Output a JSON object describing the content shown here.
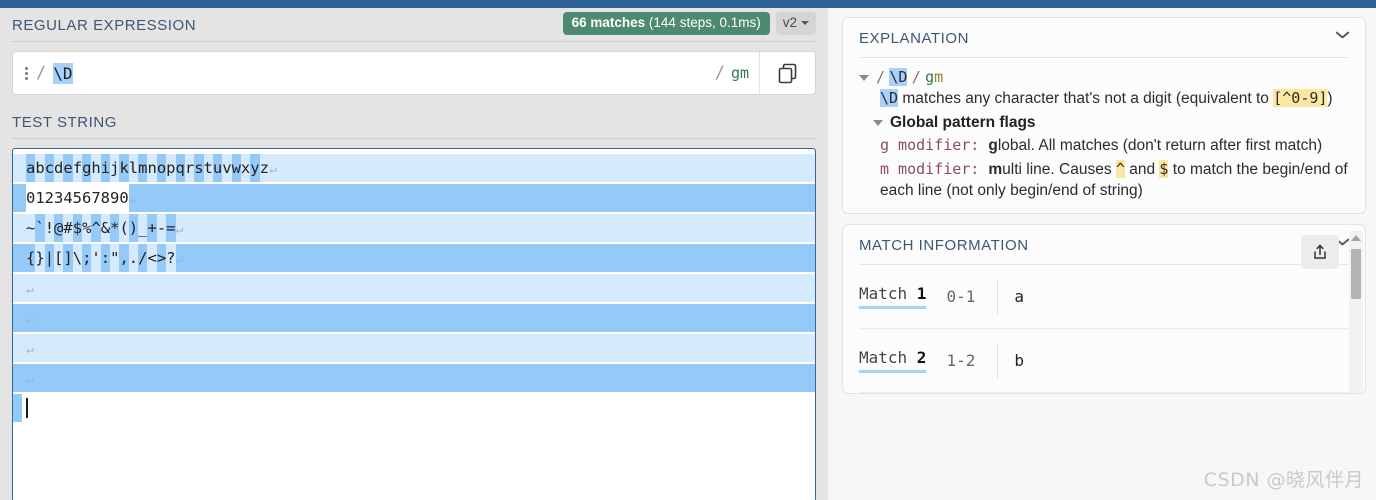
{
  "topbar": {
    "color": "#2e6094"
  },
  "left": {
    "regex_section": {
      "title": "REGULAR EXPRESSION",
      "match_badge": {
        "count_label": "66 matches",
        "stats_label": " (144 steps, 0.1ms)",
        "color": "#4d8a70"
      },
      "version_select": {
        "value": "v2"
      },
      "input": {
        "open_delimiter": "/",
        "pattern": "\\D",
        "close_delimiter": "/",
        "flags": "gm",
        "menu_icon": "kebab-menu-icon",
        "copy_icon": "copy-icon"
      }
    },
    "test_string_section": {
      "title": "TEST STRING",
      "lines": [
        {
          "text": "abcdefghijklmnopqrstuvwxyz",
          "newline_glyph": "↵",
          "fill": "light",
          "per_char": true,
          "start_phase": 0
        },
        {
          "text": "01234567890",
          "newline_glyph": "↵",
          "fill": "dark",
          "per_char": false,
          "unmatched": true
        },
        {
          "text": "~`!@#$%^&*()_+-=",
          "newline_glyph": "↵",
          "fill": "light",
          "per_char": true,
          "start_phase": 1
        },
        {
          "text": "{}|[]\\;':\",./<>?",
          "newline_glyph": "↵",
          "fill": "dark",
          "per_char": true,
          "start_phase": 0
        },
        {
          "text": "",
          "newline_glyph": "↵",
          "fill": "light",
          "per_char": false
        },
        {
          "text": "",
          "newline_glyph": "↵",
          "fill": "dark",
          "per_char": false
        },
        {
          "text": "",
          "newline_glyph": "↵",
          "fill": "light",
          "per_char": false
        },
        {
          "text": "",
          "newline_glyph": "↵",
          "fill": "dark",
          "per_char": false
        }
      ],
      "caret_line": true
    }
  },
  "right": {
    "explanation": {
      "title": "EXPLANATION",
      "pattern_row": {
        "open": "/",
        "token": "\\D",
        "close": "/",
        "flag_g": "g",
        "flag_m": "m"
      },
      "token_description_pre": " matches any character that's not a digit (equivalent to ",
      "token_description_code": "[^0-9]",
      "token_description_post": ")",
      "flags_title": "Global pattern flags",
      "modifiers": [
        {
          "key": "g",
          "label": " modifier: ",
          "bold": "g",
          "rest": "lobal. All matches (don't return after first match)"
        },
        {
          "key": "m",
          "label": " modifier: ",
          "bold": "m",
          "rest_a": "ulti line. Causes ",
          "code_a": "^",
          "rest_b": " and ",
          "code_b": "$",
          "rest_c": " to match the begin/end of each line (not only begin/end of string)"
        }
      ]
    },
    "match_information": {
      "title": "MATCH INFORMATION",
      "share_icon": "share-icon",
      "matches": [
        {
          "label": "Match ",
          "index": "1",
          "range": "0-1",
          "value": "a"
        },
        {
          "label": "Match ",
          "index": "2",
          "range": "1-2",
          "value": "b"
        }
      ]
    }
  },
  "watermark": {
    "text": "CSDN @晓风伴月"
  }
}
